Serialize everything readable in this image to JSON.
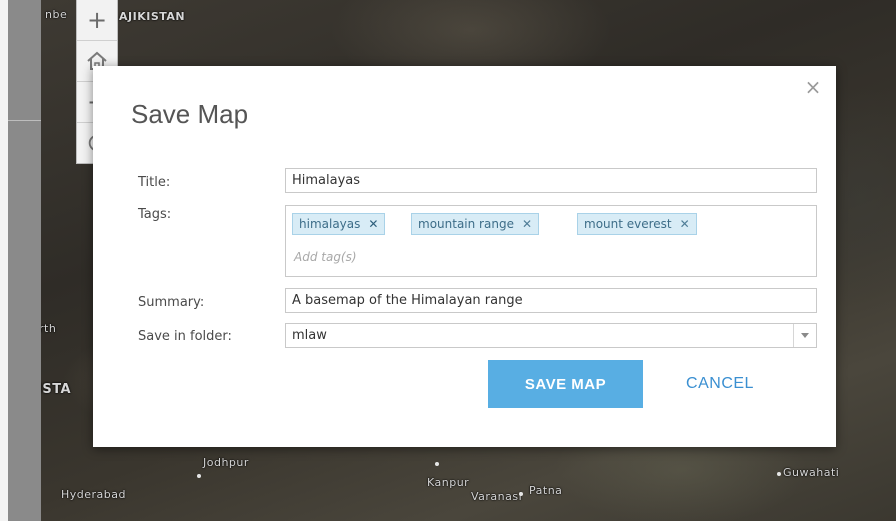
{
  "map": {
    "labels": {
      "tajikistan": "AJIKISTAN",
      "fragment_top": "nbe",
      "fragment_left_mid": "rth",
      "fragment_left_lower": "ISTA",
      "jodhpur": "Jodhpur",
      "hyderabad": "Hyderabad",
      "kanpur": "Kanpur",
      "varanasi": "Varanasi",
      "patna": "Patna",
      "guwahati": "Guwahati"
    },
    "controls": {
      "zoom_in": "+",
      "zoom_out": "−"
    }
  },
  "dialog": {
    "title": "Save Map",
    "close_symbol": "×",
    "fields": {
      "title_label": "Title:",
      "title_value": "Himalayas",
      "tags_label": "Tags:",
      "tags": [
        {
          "label": "himalayas",
          "remove": "✕"
        },
        {
          "label": "mountain range",
          "remove": "✕"
        },
        {
          "label": "mount everest",
          "remove": "✕"
        }
      ],
      "tags_placeholder": "Add tag(s)",
      "summary_label": "Summary:",
      "summary_value": "A basemap of the Himalayan range",
      "folder_label": "Save in folder:",
      "folder_value": "mlaw"
    },
    "buttons": {
      "save": "SAVE MAP",
      "cancel": "CANCEL"
    }
  },
  "colors": {
    "primary_button": "#58aee3",
    "link_button": "#3a8fd1",
    "tag_bg": "#d8ecf6"
  }
}
